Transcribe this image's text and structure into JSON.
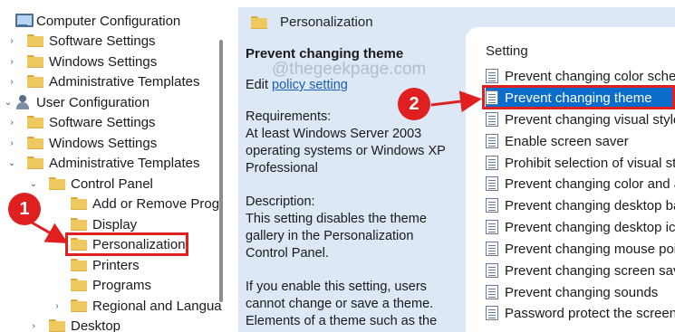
{
  "tree": {
    "items": [
      {
        "label": "Computer Configuration",
        "icon": "computer-icon",
        "twisty": ""
      },
      {
        "label": "Software Settings",
        "icon": "folder-icon",
        "twisty": "›"
      },
      {
        "label": "Windows Settings",
        "icon": "folder-icon",
        "twisty": "›"
      },
      {
        "label": "Administrative Templates",
        "icon": "folder-icon",
        "twisty": "›"
      },
      {
        "label": "User Configuration",
        "icon": "user-icon",
        "twisty": "⌄"
      },
      {
        "label": "Software Settings",
        "icon": "folder-icon",
        "twisty": "›"
      },
      {
        "label": "Windows Settings",
        "icon": "folder-icon",
        "twisty": "›"
      },
      {
        "label": "Administrative Templates",
        "icon": "folder-icon",
        "twisty": "⌄"
      },
      {
        "label": "Control Panel",
        "icon": "folder-icon",
        "twisty": "⌄"
      },
      {
        "label": "Add or Remove Prog",
        "icon": "folder-icon",
        "twisty": ""
      },
      {
        "label": "Display",
        "icon": "folder-icon",
        "twisty": ""
      },
      {
        "label": "Personalization",
        "icon": "folder-icon",
        "twisty": ""
      },
      {
        "label": "Printers",
        "icon": "folder-icon",
        "twisty": ""
      },
      {
        "label": "Programs",
        "icon": "folder-icon",
        "twisty": ""
      },
      {
        "label": "Regional and Langua",
        "icon": "folder-icon",
        "twisty": "›"
      },
      {
        "label": "Desktop",
        "icon": "folder-icon",
        "twisty": "›"
      }
    ]
  },
  "center": {
    "header": "Personalization",
    "title": "Prevent changing theme",
    "edit_prefix": "Edit ",
    "edit_link": "policy setting",
    "requirements_label": "Requirements:",
    "requirements": "At least Windows Server 2003 operating systems or Windows XP Professional",
    "description_label": "Description:",
    "description": "This setting disables the theme gallery in the Personalization Control Panel.",
    "desc_more": "If you enable this setting, users cannot change or save a theme. Elements of a theme such as the",
    "watermark": "@thegeekpage.com"
  },
  "list": {
    "header": "Setting",
    "rows": [
      "Prevent changing color schem",
      "Prevent changing theme",
      "Prevent changing visual style",
      "Enable screen saver",
      "Prohibit selection of visual sty",
      "Prevent changing color and a",
      "Prevent changing desktop ba",
      "Prevent changing desktop ico",
      "Prevent changing mouse poi",
      "Prevent changing screen save",
      "Prevent changing sounds",
      "Password protect the screen s"
    ],
    "selected_index": 1
  },
  "callouts": {
    "one": "1",
    "two": "2"
  },
  "colors": {
    "accent": "#0a6dcb",
    "callout": "#e02020",
    "pane": "#dce8f5"
  }
}
